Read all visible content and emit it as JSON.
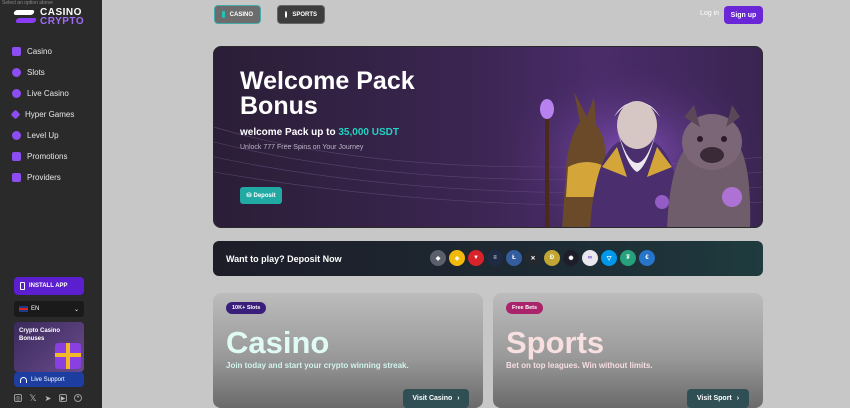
{
  "sidebar": {
    "top_note": "Select an option above",
    "logo": {
      "line1": "CASINO",
      "line2": "CRYPTO"
    },
    "items": [
      {
        "label": "Casino",
        "icon": "casino-icon"
      },
      {
        "label": "Slots",
        "icon": "slots-icon"
      },
      {
        "label": "Live Casino",
        "icon": "live-casino-icon"
      },
      {
        "label": "Hyper Games",
        "icon": "hyper-games-icon"
      },
      {
        "label": "Level Up",
        "icon": "level-up-icon"
      },
      {
        "label": "Promotions",
        "icon": "promotions-icon"
      },
      {
        "label": "Providers",
        "icon": "providers-icon"
      }
    ],
    "install_label": "INSTALL APP",
    "language": "EN",
    "promo_card": "Crypto Casino Bonuses",
    "support_label": "Live Support",
    "socials": [
      "instagram-icon",
      "x-icon",
      "telegram-icon",
      "youtube-icon",
      "discord-icon"
    ]
  },
  "header": {
    "tabs": [
      {
        "label": "CASINO",
        "active": true
      },
      {
        "label": "SPORTS",
        "active": false
      }
    ],
    "login": "Log in",
    "signup": "Sign up"
  },
  "hero": {
    "title": "Welcome Pack Bonus",
    "subtitle_prefix": "welcome Pack up to ",
    "subtitle_highlight": "35,000 USDT",
    "description": "Unlock 777 Free Spins on Your Journey",
    "deposit_label": "Deposit"
  },
  "strip": {
    "label": "Want to play? Deposit Now",
    "coins": [
      {
        "symbol": "ETH",
        "glyph": "◆",
        "color": "#5a5f6b"
      },
      {
        "symbol": "BNB",
        "glyph": "◈",
        "color": "#f0b90b"
      },
      {
        "symbol": "TRX",
        "glyph": "▼",
        "color": "#d8232a"
      },
      {
        "symbol": "SOL",
        "glyph": "≡",
        "color": "#1f2a44"
      },
      {
        "symbol": "LTC",
        "glyph": "Ł",
        "color": "#345d9d"
      },
      {
        "symbol": "XRP",
        "glyph": "✕",
        "color": "#23292f"
      },
      {
        "symbol": "DOGE",
        "glyph": "Ð",
        "color": "#c2a633"
      },
      {
        "symbol": "ADA",
        "glyph": "✺",
        "color": "#1e1e2a"
      },
      {
        "symbol": "POL",
        "glyph": "∞",
        "color": "#e8e8ee"
      },
      {
        "symbol": "TON",
        "glyph": "▽",
        "color": "#0098ea"
      },
      {
        "symbol": "USDT",
        "glyph": "₮",
        "color": "#26a17b"
      },
      {
        "symbol": "USDC",
        "glyph": "€",
        "color": "#2775ca"
      }
    ]
  },
  "cards": {
    "casino": {
      "badge": "10K+ Slots",
      "title": "Casino",
      "desc": "Join today and start your crypto winning streak.",
      "button": "Visit Casino"
    },
    "sports": {
      "badge": "Free Bets",
      "title": "Sports",
      "desc": "Bet on top leagues. Win without limits.",
      "button": "Visit Sport"
    }
  }
}
